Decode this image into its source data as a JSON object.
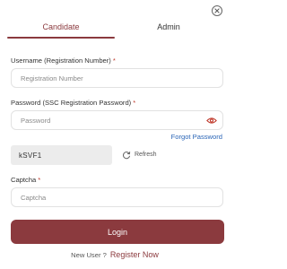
{
  "tabs": [
    {
      "label": "Candidate",
      "active": true
    },
    {
      "label": "Admin",
      "active": false
    }
  ],
  "username": {
    "label": "Username (Registration Number)",
    "required_mark": "*",
    "placeholder": "Registration Number",
    "value": ""
  },
  "password": {
    "label": "Password (SSC Registration Password)",
    "required_mark": "*",
    "placeholder": "Password",
    "value": ""
  },
  "forgot_password": "Forgot Password",
  "captcha": {
    "code": "kSVF1",
    "refresh_label": "Refresh",
    "label": "Captcha",
    "required_mark": "*",
    "placeholder": "Captcha",
    "value": ""
  },
  "login_button": "Login",
  "footer": {
    "new_user": "New User ?",
    "register": "Register Now"
  },
  "icons": {
    "close": "close-icon",
    "eye": "eye-icon",
    "refresh": "refresh-icon"
  },
  "colors": {
    "accent": "#8b3a3e",
    "link": "#2a65b6",
    "eye": "#c0392b",
    "required": "#c0392b"
  }
}
